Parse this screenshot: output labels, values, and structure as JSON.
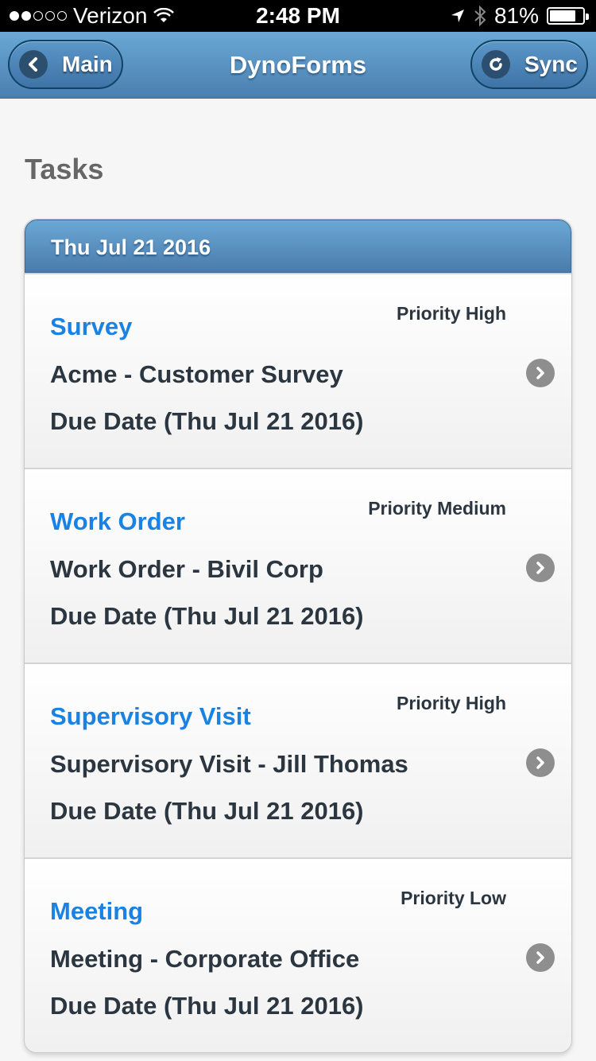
{
  "status_bar": {
    "signal_filled": 2,
    "signal_total": 5,
    "carrier": "Verizon",
    "time": "2:48 PM",
    "battery_percent_label": "81%",
    "battery_level": 0.81
  },
  "header": {
    "title": "DynoForms",
    "back_button_label": "Main",
    "sync_button_label": "Sync"
  },
  "page": {
    "title": "Tasks"
  },
  "task_group": {
    "date_header": "Thu Jul 21 2016",
    "tasks": [
      {
        "type": "Survey",
        "priority": "Priority High",
        "name": "Acme - Customer Survey",
        "due": "Due Date (Thu Jul 21 2016)"
      },
      {
        "type": "Work Order",
        "priority": "Priority Medium",
        "name": "Work Order - Bivil Corp",
        "due": "Due Date (Thu Jul 21 2016)"
      },
      {
        "type": "Supervisory Visit",
        "priority": "Priority High",
        "name": "Supervisory Visit - Jill Thomas",
        "due": "Due Date (Thu Jul 21 2016)"
      },
      {
        "type": "Meeting",
        "priority": "Priority Low",
        "name": "Meeting - Corporate Office",
        "due": "Due Date (Thu Jul 21 2016)"
      }
    ]
  },
  "colors": {
    "accent_blue": "#1a82e2",
    "header_blue": "#4a7fb0",
    "text_dark": "#2b3640"
  }
}
